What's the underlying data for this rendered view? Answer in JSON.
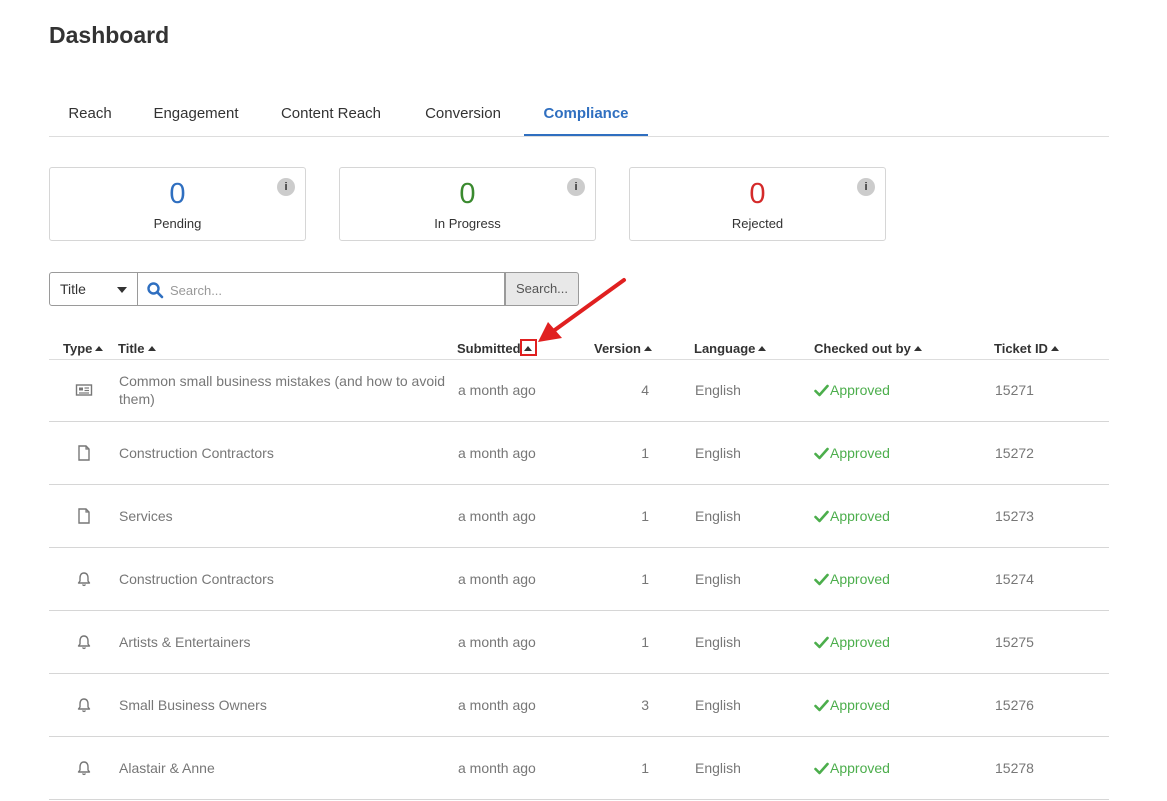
{
  "page": {
    "title": "Dashboard"
  },
  "tabs": [
    {
      "label": "Reach",
      "active": false
    },
    {
      "label": "Engagement",
      "active": false
    },
    {
      "label": "Content Reach",
      "active": false
    },
    {
      "label": "Conversion",
      "active": false
    },
    {
      "label": "Compliance",
      "active": true
    }
  ],
  "stats": [
    {
      "value": "0",
      "label": "Pending",
      "color": "#2f6fc0",
      "info": "i"
    },
    {
      "value": "0",
      "label": "In Progress",
      "color": "#3a8a2f",
      "info": "i"
    },
    {
      "value": "0",
      "label": "Rejected",
      "color": "#d42a2a",
      "info": "i"
    }
  ],
  "search": {
    "field_select": "Title",
    "placeholder": "Search...",
    "button_label": "Search..."
  },
  "table": {
    "headers": {
      "type": "Type",
      "title": "Title",
      "submitted": "Submitted",
      "version": "Version",
      "language": "Language",
      "checked_out_by": "Checked out by",
      "ticket_id": "Ticket ID"
    },
    "rows": [
      {
        "type_icon": "newspaper-icon",
        "title": "Common small business mistakes (and how to avoid them)",
        "submitted": "a month ago",
        "version": "4",
        "language": "English",
        "status": "Approved",
        "ticket_id": "15271"
      },
      {
        "type_icon": "document-icon",
        "title": "Construction Contractors",
        "submitted": "a month ago",
        "version": "1",
        "language": "English",
        "status": "Approved",
        "ticket_id": "15272"
      },
      {
        "type_icon": "document-icon",
        "title": "Services",
        "submitted": "a month ago",
        "version": "1",
        "language": "English",
        "status": "Approved",
        "ticket_id": "15273"
      },
      {
        "type_icon": "bell-icon",
        "title": "Construction Contractors",
        "submitted": "a month ago",
        "version": "1",
        "language": "English",
        "status": "Approved",
        "ticket_id": "15274"
      },
      {
        "type_icon": "bell-icon",
        "title": "Artists & Entertainers",
        "submitted": "a month ago",
        "version": "1",
        "language": "English",
        "status": "Approved",
        "ticket_id": "15275"
      },
      {
        "type_icon": "bell-icon",
        "title": "Small Business Owners",
        "submitted": "a month ago",
        "version": "3",
        "language": "English",
        "status": "Approved",
        "ticket_id": "15276"
      },
      {
        "type_icon": "bell-icon",
        "title": "Alastair & Anne",
        "submitted": "a month ago",
        "version": "1",
        "language": "English",
        "status": "Approved",
        "ticket_id": "15278"
      }
    ]
  },
  "colors": {
    "accent": "#2f6fc0",
    "approved": "#4cae4c",
    "annotation": "#e02020"
  }
}
